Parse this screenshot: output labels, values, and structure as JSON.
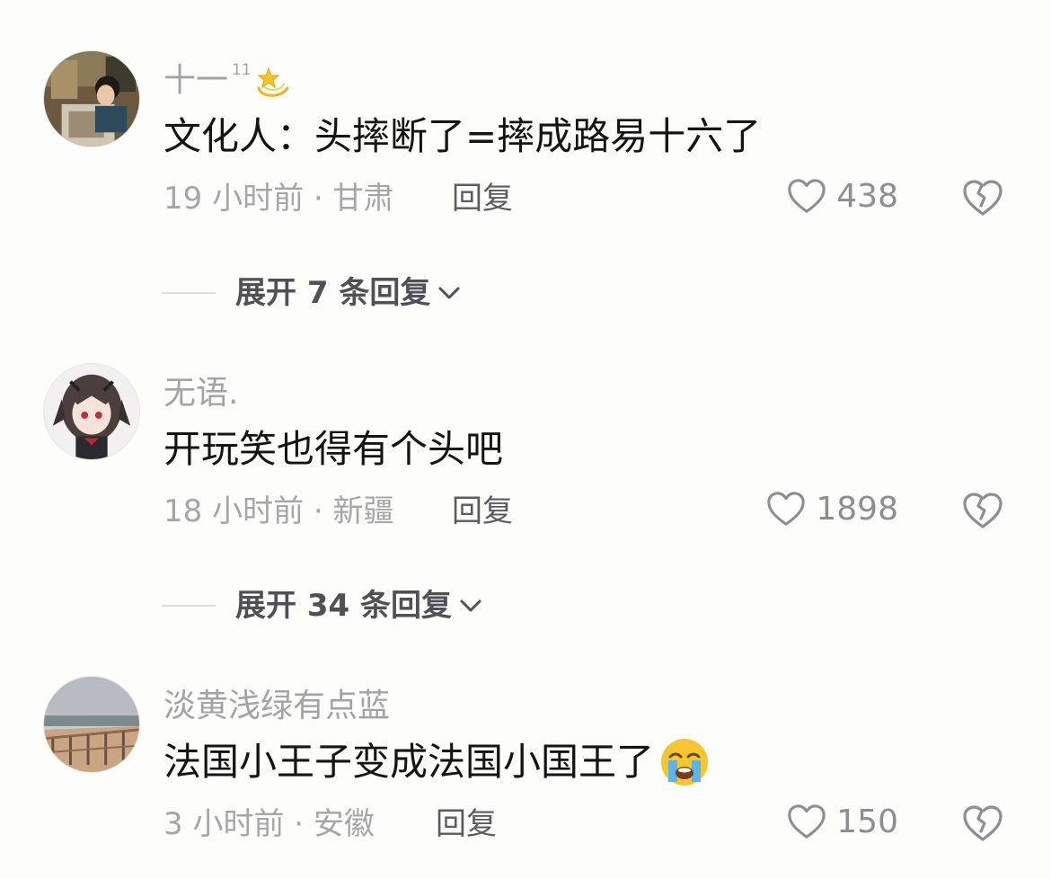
{
  "comments": [
    {
      "username": "十一",
      "badge_number": "11",
      "badge_icon": "dizzy-star-icon",
      "text": "文化人：头摔断了=摔成路易十六了",
      "time_location": "19 小时前 · 甘肃",
      "reply_label": "回复",
      "likes": "438",
      "expand_label": "展开 7 条回复"
    },
    {
      "username": "无语.",
      "text": "开玩笑也得有个头吧",
      "time_location": "18 小时前 · 新疆",
      "reply_label": "回复",
      "likes": "1898",
      "expand_label": "展开 34 条回复"
    },
    {
      "username": "淡黄浅绿有点蓝",
      "text": "法国小王子变成法国小国王了",
      "text_emoji": "loudly-crying-face-emoji",
      "time_location": "3 小时前 · 安徽",
      "reply_label": "回复",
      "likes": "150"
    }
  ],
  "colors": {
    "background": "#fdfdfb",
    "text_primary": "#141414",
    "text_secondary": "#a6a6a8",
    "reply": "#5c5c60",
    "expand": "#505055"
  }
}
